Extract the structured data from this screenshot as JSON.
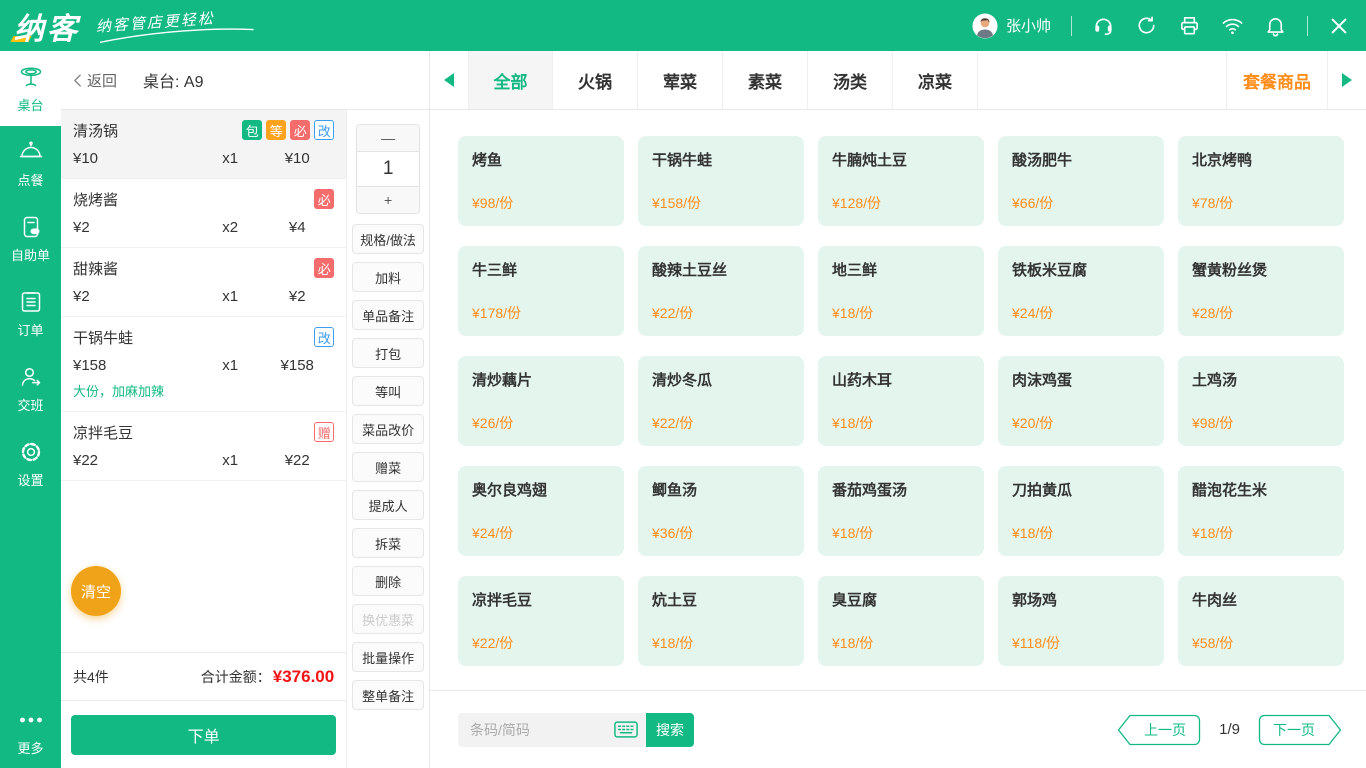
{
  "topbar": {
    "logo": "纳客",
    "slogan": "纳客管店更轻松",
    "user": "张小帅",
    "icons": [
      "avatar",
      "support-headset-icon",
      "sync-icon",
      "printer-icon",
      "wifi-icon",
      "notification-bell-icon",
      "close-icon"
    ]
  },
  "sidebar": {
    "items": [
      {
        "key": "tables",
        "label": "桌台",
        "icon": "table-icon",
        "active": true
      },
      {
        "key": "ordering",
        "label": "点餐",
        "icon": "cloche-icon",
        "active": false
      },
      {
        "key": "self-order",
        "label": "自助单",
        "icon": "self-order-icon",
        "active": false
      },
      {
        "key": "orders",
        "label": "订单",
        "icon": "order-list-icon",
        "active": false
      },
      {
        "key": "shift",
        "label": "交班",
        "icon": "shift-icon",
        "active": false
      },
      {
        "key": "settings",
        "label": "设置",
        "icon": "gear-icon",
        "active": false
      }
    ],
    "more": {
      "key": "more",
      "label": "更多",
      "icon": "more-dots-icon"
    }
  },
  "header": {
    "back_label": "返回",
    "table_title": "桌台: A9"
  },
  "order_panel": {
    "items": [
      {
        "name": "清汤锅",
        "badges": [
          {
            "text": "包",
            "style": "solid-green"
          },
          {
            "text": "等",
            "style": "solid-orange"
          },
          {
            "text": "必",
            "style": "solid-red"
          },
          {
            "text": "改",
            "style": "outline-blue"
          }
        ],
        "price": "¥10",
        "qty": "x1",
        "total": "¥10",
        "selected": true
      },
      {
        "name": "烧烤酱",
        "badges": [
          {
            "text": "必",
            "style": "solid-red"
          }
        ],
        "price": "¥2",
        "qty": "x2",
        "total": "¥4",
        "selected": false
      },
      {
        "name": "甜辣酱",
        "badges": [
          {
            "text": "必",
            "style": "solid-red"
          }
        ],
        "price": "¥2",
        "qty": "x1",
        "total": "¥2",
        "selected": false
      },
      {
        "name": "干锅牛蛙",
        "badges": [
          {
            "text": "改",
            "style": "outline-blue"
          }
        ],
        "price": "¥158",
        "qty": "x1",
        "total": "¥158",
        "note": "大份，加麻加辣",
        "selected": false
      },
      {
        "name": "凉拌毛豆",
        "badges": [
          {
            "text": "赠",
            "style": "outline-red"
          }
        ],
        "price": "¥22",
        "qty": "x1",
        "total": "¥22",
        "selected": false
      }
    ],
    "clear_label": "清空",
    "count_label": "共4件",
    "total_label": "合计金额：",
    "total_value": "¥376.00",
    "submit_label": "下单"
  },
  "actions": {
    "minus": "—",
    "quantity": "1",
    "plus": "+",
    "buttons": [
      {
        "label": "规格/做法",
        "disabled": false
      },
      {
        "label": "加料",
        "disabled": false
      },
      {
        "label": "单品备注",
        "disabled": false
      },
      {
        "label": "打包",
        "disabled": false
      },
      {
        "label": "等叫",
        "disabled": false
      },
      {
        "label": "菜品改价",
        "disabled": false
      },
      {
        "label": "赠菜",
        "disabled": false
      },
      {
        "label": "提成人",
        "disabled": false
      },
      {
        "label": "拆菜",
        "disabled": false
      },
      {
        "label": "删除",
        "disabled": false
      },
      {
        "label": "换优惠菜",
        "disabled": true
      },
      {
        "label": "批量操作",
        "disabled": false
      },
      {
        "label": "整单备注",
        "disabled": false
      }
    ]
  },
  "categories": {
    "tabs": [
      {
        "label": "全部",
        "active": true
      },
      {
        "label": "火锅",
        "active": false
      },
      {
        "label": "荤菜",
        "active": false
      },
      {
        "label": "素菜",
        "active": false
      },
      {
        "label": "汤类",
        "active": false
      },
      {
        "label": "凉菜",
        "active": false
      }
    ],
    "right_tab": "套餐商品"
  },
  "menu": {
    "items": [
      {
        "name": "烤鱼",
        "price": "¥98/份"
      },
      {
        "name": "干锅牛蛙",
        "price": "¥158/份"
      },
      {
        "name": "牛腩炖土豆",
        "price": "¥128/份"
      },
      {
        "name": "酸汤肥牛",
        "price": "¥66/份"
      },
      {
        "name": "北京烤鸭",
        "price": "¥78/份"
      },
      {
        "name": "牛三鲜",
        "price": "¥178/份"
      },
      {
        "name": "酸辣土豆丝",
        "price": "¥22/份"
      },
      {
        "name": "地三鲜",
        "price": "¥18/份"
      },
      {
        "name": "铁板米豆腐",
        "price": "¥24/份"
      },
      {
        "name": "蟹黄粉丝煲",
        "price": "¥28/份"
      },
      {
        "name": "清炒藕片",
        "price": "¥26/份"
      },
      {
        "name": "清炒冬瓜",
        "price": "¥22/份"
      },
      {
        "name": "山药木耳",
        "price": "¥18/份"
      },
      {
        "name": "肉沫鸡蛋",
        "price": "¥20/份"
      },
      {
        "name": "土鸡汤",
        "price": "¥98/份"
      },
      {
        "name": "奥尔良鸡翅",
        "price": "¥24/份"
      },
      {
        "name": "鲫鱼汤",
        "price": "¥36/份"
      },
      {
        "name": "番茄鸡蛋汤",
        "price": "¥18/份"
      },
      {
        "name": "刀拍黄瓜",
        "price": "¥18/份"
      },
      {
        "name": "醋泡花生米",
        "price": "¥18/份"
      },
      {
        "name": "凉拌毛豆",
        "price": "¥22/份"
      },
      {
        "name": "炕土豆",
        "price": "¥18/份"
      },
      {
        "name": "臭豆腐",
        "price": "¥18/份"
      },
      {
        "name": "郭场鸡",
        "price": "¥118/份"
      },
      {
        "name": "牛肉丝",
        "price": "¥58/份"
      }
    ]
  },
  "pagination": {
    "search_placeholder": "条码/简码",
    "search_label": "搜索",
    "prev_label": "上一页",
    "page": "1/9",
    "next_label": "下一页"
  },
  "colors": {
    "brand_green": "#12b982",
    "accent_orange": "#ff8d1a",
    "clear_amber": "#f0a318",
    "total_red": "#f01414",
    "badge_red": "#f56c6c",
    "badge_blue": "#3d9df2",
    "badge_orange": "#ffa21d",
    "card_mint": "#e4f5ed"
  }
}
